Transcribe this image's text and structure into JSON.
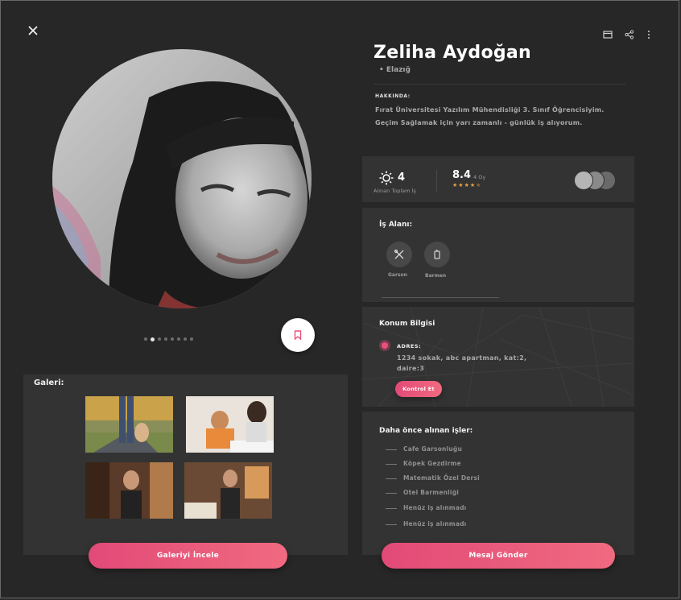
{
  "profile": {
    "name": "Zeliha Aydoğan",
    "city": "• Elazığ",
    "about_heading": "HAKKINDA:",
    "about_line1": "Fırat Üniversitesi Yazılım Mühendisliği 3. Sınıf Öğrencisiyim.",
    "about_line2": "Geçim Sağlamak için yarı zamanlı - günlük iş alıyorum."
  },
  "stats": {
    "jobs_count": "4",
    "jobs_label": "Alınan Toplam İş",
    "rating": "8.4",
    "rating_votes": "4 Oy",
    "stars_filled": 4,
    "stars_total": 5
  },
  "work_area": {
    "title": "İş Alanı:",
    "items": [
      {
        "label": "Garson",
        "icon": "utensils-icon"
      },
      {
        "label": "Barmen",
        "icon": "cocktail-icon"
      }
    ]
  },
  "location": {
    "title": "Konum Bilgisi",
    "address_heading": "ADRES:",
    "address_line1": "1234 sokak, abc apartman, kat:2,",
    "address_line2": "daire:3",
    "check_button": "Kontrol Et"
  },
  "past_jobs": {
    "title": "Daha önce alınan işler:",
    "items": [
      "Cafe Garsonluğu",
      "Köpek Gezdirme",
      "Matematik Özel Dersi",
      "Otel Barmenliği",
      "Henüz iş alınmadı",
      "Henüz iş alınmadı"
    ]
  },
  "gallery": {
    "title": "Galeri:",
    "button": "Galeriyi İncele"
  },
  "actions": {
    "message_button": "Mesaj Gönder"
  },
  "carousel": {
    "total": 8,
    "active_index": 1
  },
  "colors": {
    "accent": "#e9507a",
    "star": "#e6a545",
    "panel": "#333333",
    "background": "#272727"
  }
}
